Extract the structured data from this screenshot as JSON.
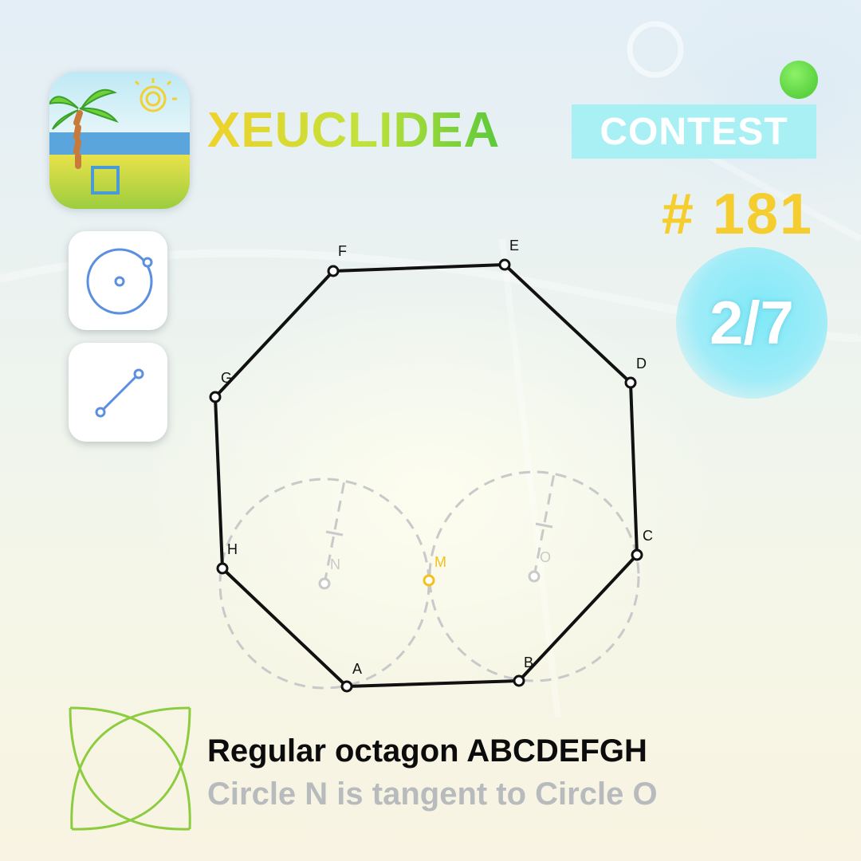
{
  "header": {
    "brand_title": "XEUCLIDEA",
    "contest_label": "CONTEST",
    "contest_number": "# 181",
    "progress": "2/7"
  },
  "toolbar": {
    "tools": [
      {
        "name": "circle-tool",
        "icon": "circle-icon"
      },
      {
        "name": "line-tool",
        "icon": "segment-icon"
      }
    ]
  },
  "construction": {
    "points": {
      "A": "A",
      "B": "B",
      "C": "C",
      "D": "D",
      "E": "E",
      "F": "F",
      "G": "G",
      "H": "H",
      "M": "M",
      "N": "N",
      "O": "O"
    }
  },
  "description": {
    "line1": "Regular octagon ABCDEFGH",
    "line2": "Circle N is tangent to Circle O"
  },
  "colors": {
    "octagon_stroke": "#111111",
    "hint_circles": "#c9c9c9",
    "highlight_point": "#f1c21b",
    "tool_blue": "#5b8fe0",
    "contest_badge": "#a8f0f4",
    "number_yellow": "#f5cd2e",
    "status_dot": "#5bd23e"
  }
}
